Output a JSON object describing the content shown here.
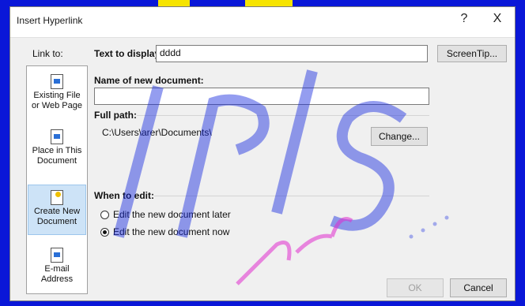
{
  "window": {
    "title": "Insert Hyperlink",
    "help_glyph": "?",
    "close_glyph": "X"
  },
  "link_to": {
    "label": "Link to:",
    "items": [
      {
        "label_line1": "Existing File",
        "label_line2": "or Web Page",
        "icon": "existing-file-icon"
      },
      {
        "label_line1": "Place in This",
        "label_line2": "Document",
        "icon": "place-in-document-icon"
      },
      {
        "label_line1": "Create New",
        "label_line2": "Document",
        "icon": "create-new-document-icon",
        "selected": true
      },
      {
        "label_line1": "E-mail",
        "label_line2": "Address",
        "icon": "email-address-icon"
      }
    ]
  },
  "text_to_display": {
    "label": "Text to display:",
    "value": "dddd"
  },
  "screentip_button": "ScreenTip...",
  "new_document": {
    "label": "Name of new document:",
    "value": ""
  },
  "full_path": {
    "label": "Full path:",
    "value": "C:\\Users\\arer\\Documents\\",
    "change_button": "Change..."
  },
  "when_to_edit": {
    "label": "When to edit:",
    "options": [
      {
        "label": "Edit the new document later",
        "selected": false
      },
      {
        "label": "Edit the new document now",
        "selected": true
      }
    ]
  },
  "buttons": {
    "ok": "OK",
    "cancel": "Cancel"
  }
}
